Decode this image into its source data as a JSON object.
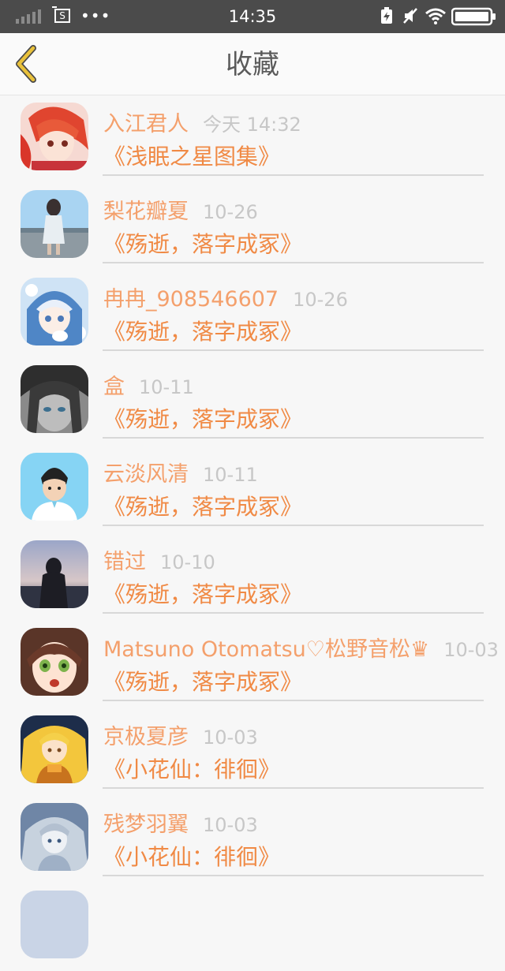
{
  "status_bar": {
    "time": "14:35",
    "sim_indicator": "S",
    "icons": [
      "signal-icon",
      "sim-icon",
      "more-dots-icon",
      "battery-saver-icon",
      "mute-icon",
      "wifi-icon",
      "battery-icon"
    ]
  },
  "header": {
    "title": "收藏",
    "back_icon": "chevron-left-icon"
  },
  "colors": {
    "username": "#f4a06c",
    "title": "#f08a45",
    "time": "#c7c7c7",
    "accent_back": "#e9c13a"
  },
  "favorites": [
    {
      "user": "入江君人",
      "time": "今天 14:32",
      "title": "《浅眠之星图集》"
    },
    {
      "user": "梨花瓣夏",
      "time": "10-26",
      "title": "《殇逝，落字成冢》"
    },
    {
      "user": "冉冉_908546607",
      "time": "10-26",
      "title": "《殇逝，落字成冢》"
    },
    {
      "user": "盒",
      "time": "10-11",
      "title": "《殇逝，落字成冢》"
    },
    {
      "user": "云淡风清",
      "time": "10-11",
      "title": "《殇逝，落字成冢》"
    },
    {
      "user": "错过",
      "time": "10-10",
      "title": "《殇逝，落字成冢》"
    },
    {
      "user": "Matsuno Otomatsu♡松野音松♛",
      "time": "10-03",
      "title": "《殇逝，落字成冢》"
    },
    {
      "user": "京极夏彦",
      "time": "10-03",
      "title": "《小花仙：徘徊》"
    },
    {
      "user": "残梦羽翼",
      "time": "10-03",
      "title": "《小花仙：徘徊》"
    }
  ]
}
